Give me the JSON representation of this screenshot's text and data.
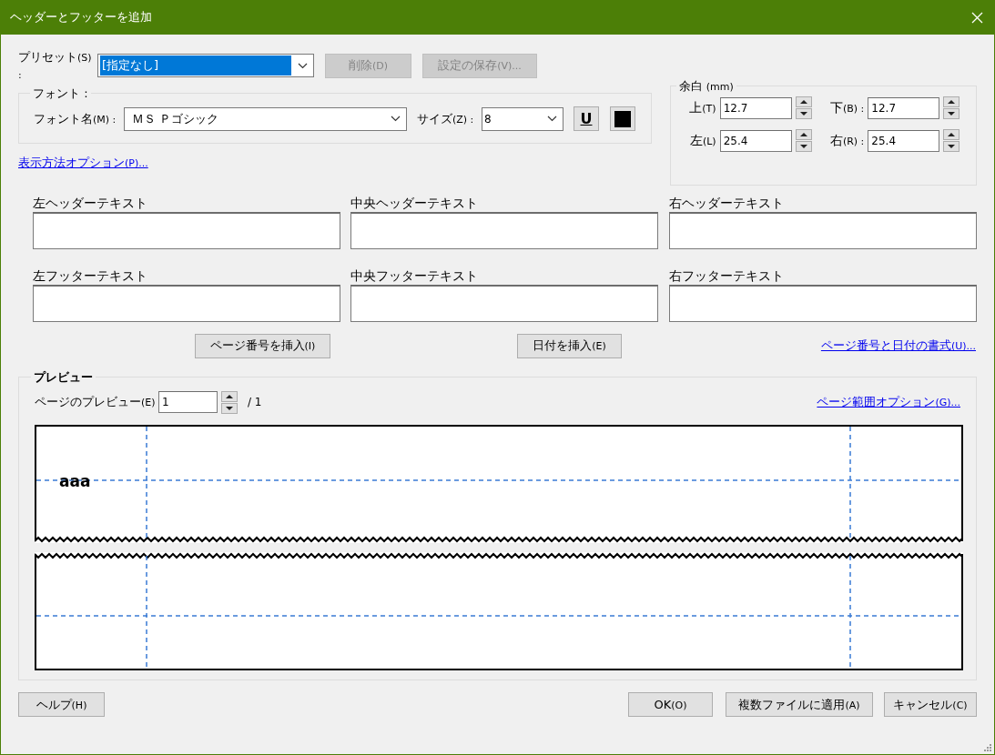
{
  "window": {
    "title": "ヘッダーとフッターを追加"
  },
  "preset": {
    "label": "プリセット",
    "key": "(S) :",
    "value": "[指定なし]",
    "highlighted": true
  },
  "preset_buttons": [
    {
      "label": "削除",
      "key": "(D)",
      "disabled": true
    },
    {
      "label": "設定の保存",
      "key": "(V)...",
      "disabled": true
    }
  ],
  "font": {
    "title": "フォント :",
    "name_label": "フォント名",
    "name_key": "(M) :",
    "name_value": "ＭＳ Ｐゴシック",
    "size_label": "サイズ",
    "size_key": "(Z) :",
    "size_value": "8",
    "underline_button": "U",
    "color": "#000000"
  },
  "display_options_link": {
    "label": "表示方法オプション",
    "key": "(P)..."
  },
  "margins": {
    "title": "余白",
    "unit": "(mm)",
    "fields": [
      {
        "label": "上",
        "key": "(T)",
        "value": "12.7"
      },
      {
        "label": "下",
        "key": "(B) :",
        "value": "12.7"
      },
      {
        "label": "左",
        "key": "(L)",
        "value": "25.4"
      },
      {
        "label": "右",
        "key": "(R) :",
        "value": "25.4"
      }
    ]
  },
  "header_fields": [
    {
      "label": "左ヘッダーテキスト"
    },
    {
      "label": "中央ヘッダーテキスト"
    },
    {
      "label": "右ヘッダーテキスト"
    }
  ],
  "footer_fields": [
    {
      "label": "左フッターテキスト"
    },
    {
      "label": "中央フッターテキスト"
    },
    {
      "label": "右フッターテキスト"
    }
  ],
  "insert_buttons": [
    {
      "label": "ページ番号を挿入",
      "key": "(I)"
    },
    {
      "label": "日付を挿入",
      "key": "(E)"
    }
  ],
  "format_link": {
    "label": "ページ番号と日付の書式",
    "key": "(U)..."
  },
  "preview": {
    "title": "プレビュー",
    "page_label": "ページのプレビュー",
    "page_key": "(E)",
    "page_value": "1",
    "page_total": "/ 1",
    "range_link": {
      "label": "ページ範囲オプション",
      "key": "(G)..."
    },
    "header_text": "aaa"
  },
  "buttons": [
    {
      "label": "ヘルプ",
      "key": "(H)"
    },
    {
      "label": "OK",
      "key": "(O)"
    },
    {
      "label": "複数ファイルに適用",
      "key": "(A)"
    },
    {
      "label": "キャンセル",
      "key": "(C)"
    }
  ]
}
